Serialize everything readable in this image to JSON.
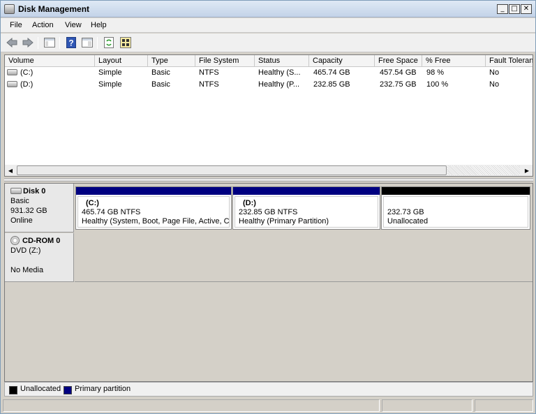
{
  "window": {
    "title": "Disk Management",
    "minimize_glyph": "_",
    "maximize_glyph": "□",
    "close_glyph": "✕"
  },
  "menubar": {
    "items": [
      "File",
      "Action",
      "View",
      "Help"
    ]
  },
  "toolbar": {
    "icons": [
      "back-arrow-icon",
      "forward-arrow-icon",
      "console-tree-icon",
      "help-icon",
      "properties-icon",
      "refresh-icon",
      "rescan-disks-icon"
    ]
  },
  "volumes": {
    "columns": [
      "Volume",
      "Layout",
      "Type",
      "File System",
      "Status",
      "Capacity",
      "Free Space",
      "% Free",
      "Fault Toleran"
    ],
    "rows": [
      {
        "volume": "(C:)",
        "layout": "Simple",
        "type": "Basic",
        "fs": "NTFS",
        "status": "Healthy (S...",
        "capacity": "465.74 GB",
        "free": "457.54 GB",
        "pct": "98 %",
        "fault": "No"
      },
      {
        "volume": "(D:)",
        "layout": "Simple",
        "type": "Basic",
        "fs": "NTFS",
        "status": "Healthy (P...",
        "capacity": "232.85 GB",
        "free": "232.75 GB",
        "pct": "100 %",
        "fault": "No"
      }
    ]
  },
  "disks": [
    {
      "name": "Disk 0",
      "type": "Basic",
      "size": "931.32 GB",
      "state": "Online",
      "partitions": [
        {
          "letter": "(C:)",
          "size": "465.74 GB NTFS",
          "status": "Healthy (System, Boot, Page File, Active, C",
          "color": "#000080"
        },
        {
          "letter": "(D:)",
          "size": "232.85 GB NTFS",
          "status": "Healthy (Primary Partition)",
          "color": "#000080"
        },
        {
          "letter": "",
          "size": "232.73 GB",
          "status": "Unallocated",
          "color": "#000000"
        }
      ]
    },
    {
      "name": "CD-ROM 0",
      "type": "DVD (Z:)",
      "size": "",
      "state": "No Media"
    }
  ],
  "legend": [
    {
      "label": "Unallocated",
      "color": "#000000"
    },
    {
      "label": "Primary partition",
      "color": "#000080"
    }
  ]
}
